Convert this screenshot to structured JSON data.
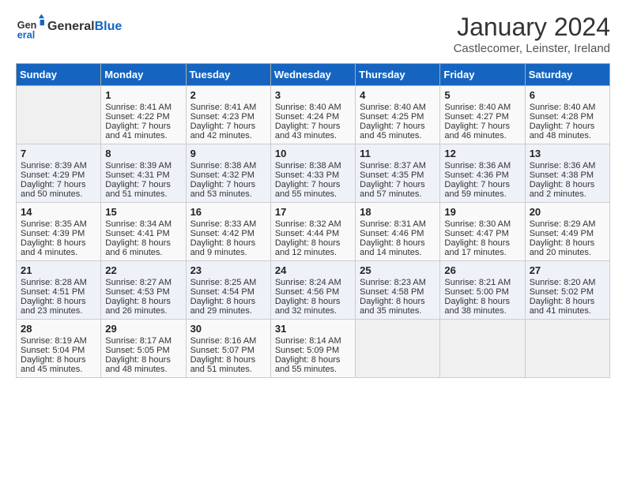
{
  "header": {
    "logo_general": "General",
    "logo_blue": "Blue",
    "month_year": "January 2024",
    "location": "Castlecomer, Leinster, Ireland"
  },
  "days_of_week": [
    "Sunday",
    "Monday",
    "Tuesday",
    "Wednesday",
    "Thursday",
    "Friday",
    "Saturday"
  ],
  "weeks": [
    [
      {
        "day": "",
        "content": ""
      },
      {
        "day": "1",
        "content": "Sunrise: 8:41 AM\nSunset: 4:22 PM\nDaylight: 7 hours\nand 41 minutes."
      },
      {
        "day": "2",
        "content": "Sunrise: 8:41 AM\nSunset: 4:23 PM\nDaylight: 7 hours\nand 42 minutes."
      },
      {
        "day": "3",
        "content": "Sunrise: 8:40 AM\nSunset: 4:24 PM\nDaylight: 7 hours\nand 43 minutes."
      },
      {
        "day": "4",
        "content": "Sunrise: 8:40 AM\nSunset: 4:25 PM\nDaylight: 7 hours\nand 45 minutes."
      },
      {
        "day": "5",
        "content": "Sunrise: 8:40 AM\nSunset: 4:27 PM\nDaylight: 7 hours\nand 46 minutes."
      },
      {
        "day": "6",
        "content": "Sunrise: 8:40 AM\nSunset: 4:28 PM\nDaylight: 7 hours\nand 48 minutes."
      }
    ],
    [
      {
        "day": "7",
        "content": "Sunrise: 8:39 AM\nSunset: 4:29 PM\nDaylight: 7 hours\nand 50 minutes."
      },
      {
        "day": "8",
        "content": "Sunrise: 8:39 AM\nSunset: 4:31 PM\nDaylight: 7 hours\nand 51 minutes."
      },
      {
        "day": "9",
        "content": "Sunrise: 8:38 AM\nSunset: 4:32 PM\nDaylight: 7 hours\nand 53 minutes."
      },
      {
        "day": "10",
        "content": "Sunrise: 8:38 AM\nSunset: 4:33 PM\nDaylight: 7 hours\nand 55 minutes."
      },
      {
        "day": "11",
        "content": "Sunrise: 8:37 AM\nSunset: 4:35 PM\nDaylight: 7 hours\nand 57 minutes."
      },
      {
        "day": "12",
        "content": "Sunrise: 8:36 AM\nSunset: 4:36 PM\nDaylight: 7 hours\nand 59 minutes."
      },
      {
        "day": "13",
        "content": "Sunrise: 8:36 AM\nSunset: 4:38 PM\nDaylight: 8 hours\nand 2 minutes."
      }
    ],
    [
      {
        "day": "14",
        "content": "Sunrise: 8:35 AM\nSunset: 4:39 PM\nDaylight: 8 hours\nand 4 minutes."
      },
      {
        "day": "15",
        "content": "Sunrise: 8:34 AM\nSunset: 4:41 PM\nDaylight: 8 hours\nand 6 minutes."
      },
      {
        "day": "16",
        "content": "Sunrise: 8:33 AM\nSunset: 4:42 PM\nDaylight: 8 hours\nand 9 minutes."
      },
      {
        "day": "17",
        "content": "Sunrise: 8:32 AM\nSunset: 4:44 PM\nDaylight: 8 hours\nand 12 minutes."
      },
      {
        "day": "18",
        "content": "Sunrise: 8:31 AM\nSunset: 4:46 PM\nDaylight: 8 hours\nand 14 minutes."
      },
      {
        "day": "19",
        "content": "Sunrise: 8:30 AM\nSunset: 4:47 PM\nDaylight: 8 hours\nand 17 minutes."
      },
      {
        "day": "20",
        "content": "Sunrise: 8:29 AM\nSunset: 4:49 PM\nDaylight: 8 hours\nand 20 minutes."
      }
    ],
    [
      {
        "day": "21",
        "content": "Sunrise: 8:28 AM\nSunset: 4:51 PM\nDaylight: 8 hours\nand 23 minutes."
      },
      {
        "day": "22",
        "content": "Sunrise: 8:27 AM\nSunset: 4:53 PM\nDaylight: 8 hours\nand 26 minutes."
      },
      {
        "day": "23",
        "content": "Sunrise: 8:25 AM\nSunset: 4:54 PM\nDaylight: 8 hours\nand 29 minutes."
      },
      {
        "day": "24",
        "content": "Sunrise: 8:24 AM\nSunset: 4:56 PM\nDaylight: 8 hours\nand 32 minutes."
      },
      {
        "day": "25",
        "content": "Sunrise: 8:23 AM\nSunset: 4:58 PM\nDaylight: 8 hours\nand 35 minutes."
      },
      {
        "day": "26",
        "content": "Sunrise: 8:21 AM\nSunset: 5:00 PM\nDaylight: 8 hours\nand 38 minutes."
      },
      {
        "day": "27",
        "content": "Sunrise: 8:20 AM\nSunset: 5:02 PM\nDaylight: 8 hours\nand 41 minutes."
      }
    ],
    [
      {
        "day": "28",
        "content": "Sunrise: 8:19 AM\nSunset: 5:04 PM\nDaylight: 8 hours\nand 45 minutes."
      },
      {
        "day": "29",
        "content": "Sunrise: 8:17 AM\nSunset: 5:05 PM\nDaylight: 8 hours\nand 48 minutes."
      },
      {
        "day": "30",
        "content": "Sunrise: 8:16 AM\nSunset: 5:07 PM\nDaylight: 8 hours\nand 51 minutes."
      },
      {
        "day": "31",
        "content": "Sunrise: 8:14 AM\nSunset: 5:09 PM\nDaylight: 8 hours\nand 55 minutes."
      },
      {
        "day": "",
        "content": ""
      },
      {
        "day": "",
        "content": ""
      },
      {
        "day": "",
        "content": ""
      }
    ]
  ]
}
